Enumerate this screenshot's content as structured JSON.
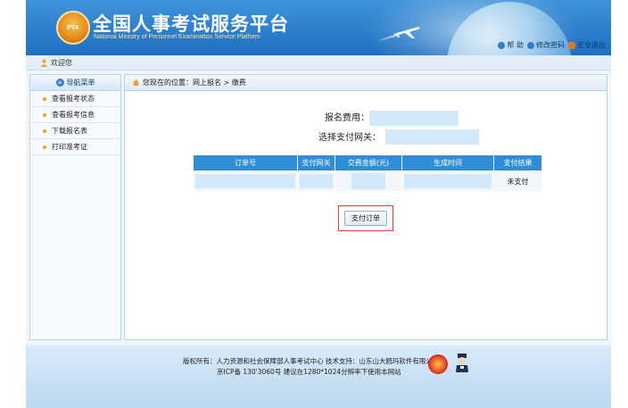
{
  "header": {
    "logo_text": "PTA",
    "title": "全国人事考试服务平台",
    "subtitle": "National Ministry of Personnel Examination Service Platform",
    "links": [
      {
        "label": "帮 助",
        "icon": "help-icon",
        "color": "#2f7fd1"
      },
      {
        "label": "修改密码",
        "icon": "key-icon",
        "color": "#2f7fd1"
      },
      {
        "label": "安全退出",
        "icon": "logout-icon",
        "color": "#e07a1c"
      }
    ]
  },
  "welcome": {
    "text": "欢迎您"
  },
  "sidebar": {
    "title": "导航菜单",
    "items": [
      {
        "label": "查看报考状态"
      },
      {
        "label": "查看报考信息"
      },
      {
        "label": "下载报名表"
      },
      {
        "label": "打印准考证"
      }
    ]
  },
  "breadcrumb": {
    "text": "您现在的位置：网上报名 > 缴费"
  },
  "payment": {
    "fee_label": "报名费用：",
    "gateway_label": "选择支付网关："
  },
  "orders": {
    "columns": [
      "订单号",
      "支付网关",
      "交费金额(元)",
      "生成时间",
      "支付结果"
    ],
    "rows": [
      {
        "order_no": "",
        "gateway": "",
        "amount": "",
        "created": "",
        "result": "未支付"
      }
    ]
  },
  "actions": {
    "pay_label": "支付订单"
  },
  "footer": {
    "line1": "版权所有：人力资源和社会保障部人事考试中心 技术支持：山东山大鸥玛软件有限公司",
    "line2": "京ICP备 130'3060号 建议在1280*1024分辨率下使用本网站"
  },
  "colors": {
    "accent": "#2f8ed6",
    "header": "#2a7fd0",
    "highlight": "#e53c3c",
    "masked": "#d3e9fa"
  }
}
